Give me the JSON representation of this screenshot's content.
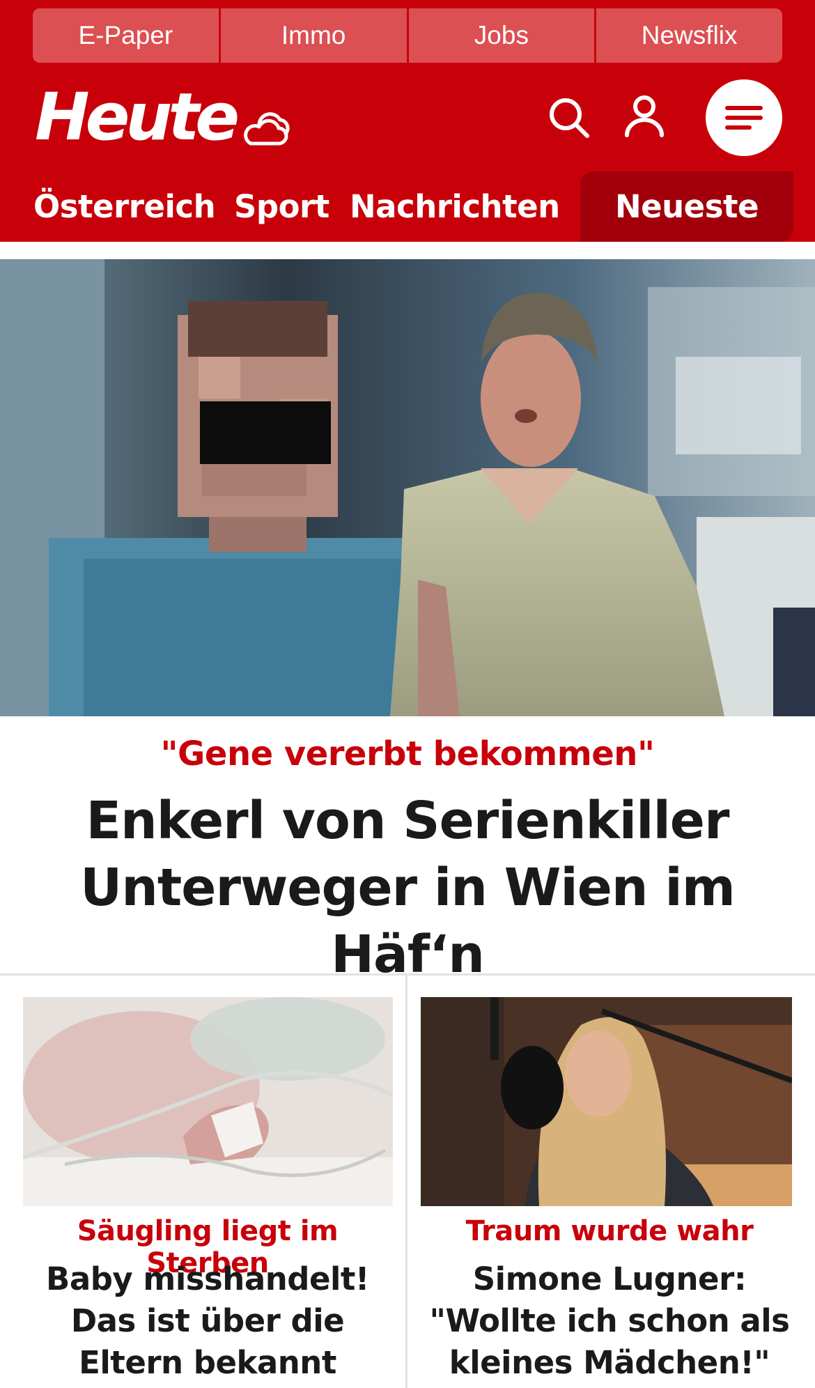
{
  "quicklinks": [
    "E-Paper",
    "Immo",
    "Jobs",
    "Newsflix"
  ],
  "brand": {
    "logo_text": "Heute",
    "accent_color": "#c8000a",
    "nav_active_color": "#a1000a"
  },
  "header_icons": [
    "cloud-sun-icon",
    "search-icon",
    "user-icon",
    "menu-icon"
  ],
  "nav": {
    "items": [
      "Österreich",
      "Sport",
      "Nachrichten"
    ],
    "active": "Neueste"
  },
  "hero": {
    "kicker": "\"Gene vererbt bekommen\"",
    "title": "Enkerl von Serienkiller Unterweger in Wien im Häf‘n"
  },
  "teasers": [
    {
      "kicker": "Säugling liegt im Sterben",
      "title": "Baby misshandelt! Das ist über die Eltern bekannt"
    },
    {
      "kicker": "Traum wurde wahr",
      "title": "Simone Lugner: \"Wollte ich schon als kleines Mädchen!\""
    }
  ]
}
